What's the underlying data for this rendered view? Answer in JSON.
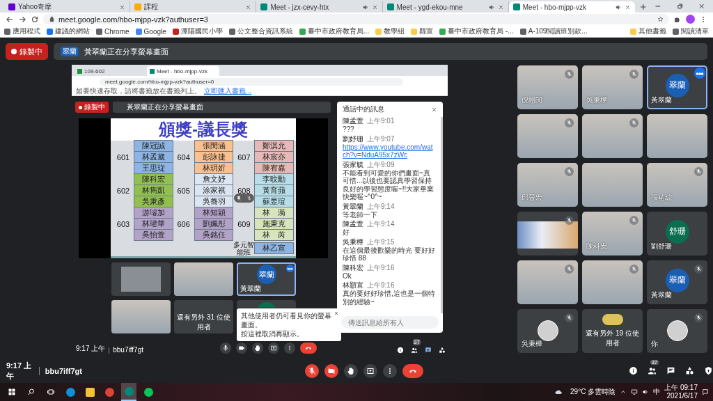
{
  "browser": {
    "tabs": [
      {
        "kind": "yahoo",
        "label": "Yahoo奇摩",
        "audio": false,
        "selected": false
      },
      {
        "kind": "course",
        "label": "課程",
        "audio": false,
        "selected": false
      },
      {
        "kind": "meet",
        "label": "Meet - jzx-cevy-htx",
        "audio": true,
        "selected": false
      },
      {
        "kind": "meet",
        "label": "Meet - ygd-ekou-mne",
        "audio": true,
        "selected": false
      },
      {
        "kind": "meet",
        "label": "Meet - hbo-mjpp-vzk",
        "audio": true,
        "selected": true
      }
    ],
    "url": "meet.google.com/hbo-mjpp-vzk?authuser=3",
    "bookmarks": [
      {
        "kind": "apps",
        "label": "應用程式"
      },
      {
        "kind": "b",
        "label": "建議的網站"
      },
      {
        "kind": "globe",
        "label": "Chrome"
      },
      {
        "kind": "g",
        "label": "Google"
      },
      {
        "kind": "school",
        "label": "潭陽國民小學"
      },
      {
        "kind": "globe",
        "label": "公文整合資訊系統"
      },
      {
        "kind": "edu",
        "label": "臺中市政府教育局..."
      },
      {
        "kind": "folder",
        "label": "教學組"
      },
      {
        "kind": "folder",
        "label": "縣宣"
      },
      {
        "kind": "edu",
        "label": "臺中市政府教育局 -..."
      },
      {
        "kind": "globe",
        "label": "A-109閱讀班別款..."
      }
    ],
    "bookmarks_right": [
      {
        "kind": "folder",
        "label": "其他書籤"
      },
      {
        "kind": "list",
        "label": "閱讀清單"
      }
    ]
  },
  "meet": {
    "recording": "錄製中",
    "banner_initials": "翠蘭",
    "banner": "黃翠蘭正在分享螢幕畫面",
    "shared": {
      "tabs": [
        {
          "kind": "classroom",
          "label": "109-602",
          "selected": false
        },
        {
          "kind": "meet",
          "label": "Meet - hbo-mjpp-vzk",
          "selected": true
        }
      ],
      "url": "meet.google.com/hbo-mjpp-vzk?authuser=0",
      "hint": "如要快速存取，請將書籤放在書籤列上。",
      "hint_link": "立即匯入書籤...",
      "recording": "錄製中",
      "banner": "黃翠蘭正在分享螢幕畫面",
      "slide": {
        "title": "頒獎-議長獎",
        "columns": [
          [
            {
              "label": "601",
              "color": "#8db4e2",
              "names": [
                "陳冠誠",
                "林孟葳",
                "王思琁"
              ]
            },
            {
              "label": "602",
              "color": "#92c050",
              "names": [
                "陳科宏",
                "林雋凱",
                "吳秉彥"
              ]
            },
            {
              "label": "603",
              "color": "#b3a2c7",
              "names": [
                "游璿加",
                "林瓘華",
                "吳怡萱"
              ]
            }
          ],
          [
            {
              "label": "604",
              "color": "#fac090",
              "names": [
                "張閔涵",
                "彭詠捷",
                "林玥妡"
              ]
            },
            {
              "label": "605",
              "color": "#dce6f2",
              "names": [
                "詹文妤",
                "涂家祺",
                "吳蕎羽"
              ]
            },
            {
              "label": "606",
              "color": "#b3a2c7",
              "names": [
                "林知穎",
                "劉姵彤",
                "吳銘任"
              ]
            }
          ],
          [
            {
              "label": "607",
              "color": "#e6b9b8",
              "names": [
                "鄭淇允",
                "林宸亦",
                "陳宥嘉"
              ]
            },
            {
              "label": "608",
              "color": "#b7dee8",
              "names": [
                "李旼勳",
                "黃育蘋",
                "蘇昱瑄"
              ]
            },
            {
              "label": "609",
              "color": "#d7e4bd",
              "names": [
                "林　漪",
                "施秉克",
                "林　芮"
              ]
            },
            {
              "label": "多元智能班",
              "color": "#8db4e2",
              "names": [
                "林乙宣"
              ]
            }
          ]
        ]
      },
      "chat": {
        "title": "通話中的訊息",
        "placeholder": "傳送訊息給所有人",
        "messages": [
          {
            "sender": "陳孟萱",
            "time": "上午9:01",
            "text": "???",
            "link": false
          },
          {
            "sender": "劉妤珊",
            "time": "上午9:07",
            "text": "https://www.youtube.com/watch?v=NduA95x7zWc",
            "link": true
          },
          {
            "sender": "張家毓",
            "time": "上午9:09",
            "text": "不能看到可愛的你們畫面~真可惜...以後也要認真學習保持良好的學習態度喔~!!大家畢業快樂喔~^0^~",
            "link": false
          },
          {
            "sender": "黃翠蘭",
            "time": "上午9:14",
            "text": "等老師一下",
            "link": false
          },
          {
            "sender": "陳孟萱",
            "time": "上午9:14",
            "text": "好",
            "link": false
          },
          {
            "sender": "吳秉樺",
            "time": "上午9:15",
            "text": "在這個最後歡樂的時光 要好好珍惜 88",
            "link": false
          },
          {
            "sender": "陳科宏",
            "time": "上午9:16",
            "text": "Ok",
            "link": false
          },
          {
            "sender": "林顥宣",
            "time": "上午9:16",
            "text": "真的要好好珍惜,這也是一個特別的經驗~",
            "link": false
          }
        ]
      },
      "tiles": [
        {
          "kind": "screen",
          "highlighted": false
        },
        {
          "kind": "video",
          "highlighted": false
        },
        {
          "kind": "avatar",
          "initials": "翠蘭",
          "name": "黃翠蘭",
          "color": "#1a5fb4",
          "highlighted": true
        },
        {
          "kind": "video",
          "highlighted": false
        },
        {
          "kind": "more",
          "label": "還有另外 31 位使用者",
          "highlighted": false
        },
        {
          "kind": "avatar",
          "color": "#0b6e4f",
          "highlighted": false
        }
      ],
      "tooltip": [
        "其他使用者仍可看見你的螢幕畫面。",
        "按這裡取消再顯示。"
      ],
      "time": "9:17 上午",
      "code": "bbu7iff7gt",
      "controls": [
        {
          "kind": "mic",
          "off": false
        },
        {
          "kind": "camera",
          "off": false
        },
        {
          "kind": "hand",
          "off": false
        },
        {
          "kind": "present",
          "off": false
        },
        {
          "kind": "more",
          "off": false
        },
        {
          "kind": "hangup"
        }
      ],
      "side_buttons": [
        {
          "kind": "info",
          "selected": false
        },
        {
          "kind": "people",
          "badge": "37",
          "selected": false
        },
        {
          "kind": "chat",
          "selected": true
        },
        {
          "kind": "activities",
          "selected": false
        }
      ]
    },
    "tiles": [
      {
        "kind": "video",
        "name": "倪翊閔",
        "muted": true,
        "highlighted": false
      },
      {
        "kind": "video",
        "name": "吳秉樺",
        "muted": true,
        "highlighted": false
      },
      {
        "kind": "avatar",
        "initials": "翠蘭",
        "name": "黃翠蘭",
        "color": "#1a5fb4",
        "muted": false,
        "highlighted": true
      },
      {
        "kind": "video",
        "muted": true,
        "highlighted": false
      },
      {
        "kind": "video",
        "muted": true,
        "highlighted": false
      },
      {
        "kind": "video",
        "muted": false,
        "highlighted": false
      },
      {
        "kind": "video",
        "name": "邱晉宏",
        "muted": true,
        "highlighted": false
      },
      {
        "kind": "video",
        "muted": false,
        "highlighted": false
      },
      {
        "kind": "video",
        "name": "張祐綜",
        "muted": true,
        "highlighted": false
      },
      {
        "kind": "screen",
        "muted": true,
        "highlighted": false
      },
      {
        "kind": "video",
        "name": "陳科宏",
        "muted": true,
        "highlighted": false
      },
      {
        "kind": "avatar",
        "initials": "舒珊",
        "name": "劉舒珊",
        "color": "#0b6e4f",
        "muted": false,
        "highlighted": false
      },
      {
        "kind": "video",
        "muted": true,
        "highlighted": false
      },
      {
        "kind": "video",
        "muted": true,
        "highlighted": false
      },
      {
        "kind": "avatar",
        "initials": "翠蘭",
        "name": "黃翠蘭",
        "color": "#1a5fb4",
        "muted": true,
        "highlighted": false
      },
      {
        "kind": "photo-avatar",
        "name": "吳秉樺",
        "muted": true,
        "highlighted": false
      },
      {
        "kind": "more",
        "label": "還有另外 19 位使用者",
        "muted": false,
        "highlighted": false
      },
      {
        "kind": "photo-avatar",
        "name": "你",
        "muted": true,
        "highlighted": false
      }
    ],
    "time": "9:17 上午",
    "code": "bbu7iff7gt",
    "controls": [
      {
        "kind": "mic",
        "off": true
      },
      {
        "kind": "camera",
        "off": true
      },
      {
        "kind": "hand",
        "off": false
      },
      {
        "kind": "present",
        "off": false
      },
      {
        "kind": "more",
        "off": false
      },
      {
        "kind": "hangup"
      }
    ],
    "side_buttons": [
      {
        "kind": "info",
        "selected": false
      },
      {
        "kind": "people",
        "badge": "37",
        "selected": false
      },
      {
        "kind": "chat",
        "selected": false
      },
      {
        "kind": "activities",
        "selected": false
      },
      {
        "kind": "lock",
        "selected": false
      }
    ]
  },
  "taskbar": {
    "apps": [
      {
        "kind": "edge",
        "selected": false
      },
      {
        "kind": "folder",
        "selected": false
      },
      {
        "kind": "chrome",
        "selected": false
      },
      {
        "kind": "meet",
        "selected": true
      },
      {
        "kind": "line",
        "selected": false
      }
    ],
    "weather": "29°C 多雲時陰",
    "ime": "中",
    "time": "上午 09:17",
    "date": "2021/6/17"
  }
}
